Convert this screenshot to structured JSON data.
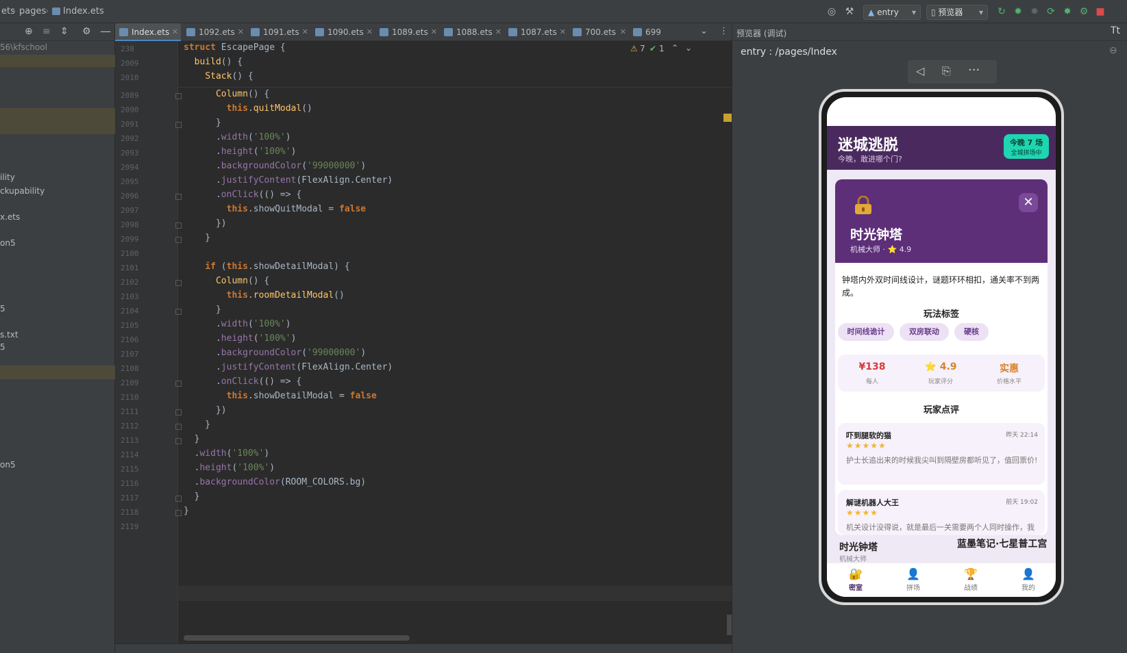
{
  "breadcrumb": {
    "seg1": "ets",
    "seg2": "pages",
    "seg3": "Index.ets"
  },
  "toolbar": {
    "run_config": "entry",
    "device": "预览器"
  },
  "project": {
    "root": "56\\kfschool",
    "items": [
      "ility",
      "ckupability",
      "x.ets",
      "on5",
      "5",
      "s.txt",
      "5",
      "on5"
    ]
  },
  "tabs": [
    {
      "label": "Index.ets",
      "active": true
    },
    {
      "label": "1092.ets"
    },
    {
      "label": "1091.ets"
    },
    {
      "label": "1090.ets"
    },
    {
      "label": "1089.ets"
    },
    {
      "label": "1088.ets"
    },
    {
      "label": "1087.ets"
    },
    {
      "label": "700.ets"
    },
    {
      "label": "699"
    }
  ],
  "editor": {
    "warnings": "7",
    "checks": "1",
    "sticky_lines": [
      {
        "num": "238",
        "code": "struct EscapePage {"
      },
      {
        "num": "2009",
        "code": "  build() {"
      },
      {
        "num": "2010",
        "code": "    Stack() {"
      }
    ],
    "lines": [
      {
        "num": "2089",
        "code": "      Column() {"
      },
      {
        "num": "2090",
        "code": "        this.quitModal()"
      },
      {
        "num": "2091",
        "code": "      }"
      },
      {
        "num": "2092",
        "code": "      .width('100%')"
      },
      {
        "num": "2093",
        "code": "      .height('100%')"
      },
      {
        "num": "2094",
        "code": "      .backgroundColor('99000000')"
      },
      {
        "num": "2095",
        "code": "      .justifyContent(FlexAlign.Center)"
      },
      {
        "num": "2096",
        "code": "      .onClick(() => {"
      },
      {
        "num": "2097",
        "code": "        this.showQuitModal = false"
      },
      {
        "num": "2098",
        "code": "      })"
      },
      {
        "num": "2099",
        "code": "    }"
      },
      {
        "num": "2100",
        "code": ""
      },
      {
        "num": "2101",
        "code": "    if (this.showDetailModal) {"
      },
      {
        "num": "2102",
        "code": "      Column() {"
      },
      {
        "num": "2103",
        "code": "        this.roomDetailModal()"
      },
      {
        "num": "2104",
        "code": "      }"
      },
      {
        "num": "2105",
        "code": "      .width('100%')"
      },
      {
        "num": "2106",
        "code": "      .height('100%')"
      },
      {
        "num": "2107",
        "code": "      .backgroundColor('99000000')"
      },
      {
        "num": "2108",
        "code": "      .justifyContent(FlexAlign.Center)"
      },
      {
        "num": "2109",
        "code": "      .onClick(() => {"
      },
      {
        "num": "2110",
        "code": "        this.showDetailModal = false"
      },
      {
        "num": "2111",
        "code": "      })"
      },
      {
        "num": "2112",
        "code": "    }"
      },
      {
        "num": "2113",
        "code": "  }"
      },
      {
        "num": "2114",
        "code": "  .width('100%')"
      },
      {
        "num": "2115",
        "code": "  .height('100%')"
      },
      {
        "num": "2116",
        "code": "  .backgroundColor(ROOM_COLORS.bg)"
      },
      {
        "num": "2117",
        "code": "  }"
      },
      {
        "num": "2118",
        "code": "}"
      },
      {
        "num": "2119",
        "code": ""
      }
    ]
  },
  "previewer": {
    "title": "预览器 (调试)",
    "route": "entry : /pages/Index"
  },
  "app": {
    "title": "迷城逃脱",
    "subtitle": "今晚，敢进哪个门?",
    "badge_main": "今晚 7 场",
    "badge_sub": "全城拼场中",
    "modal": {
      "room_name": "时光钟塔",
      "meta": "机械大师 · ⭐ 4.9",
      "description": "钟塔内外双时间线设计，谜题环环相扣，通关率不到两成。",
      "tags_title": "玩法标签",
      "tags": [
        "时间线诡计",
        "双房联动",
        "硬核"
      ],
      "stats": [
        {
          "value": "¥138",
          "label": "每人",
          "color": "#d93a3a"
        },
        {
          "value": "⭐ 4.9",
          "label": "玩家评分",
          "color": "#d9832a"
        },
        {
          "value": "实惠",
          "label": "价格水平",
          "color": "#d9832a"
        }
      ],
      "reviews_title": "玩家点评",
      "reviews": [
        {
          "user": "吓到腿软的猫",
          "date": "昨天 22:14",
          "stars": "★★★★★",
          "content": "护士长追出来的时候我尖叫到隔壁房都听见了，值回票价!"
        },
        {
          "user": "解谜机器人大王",
          "date": "前天 19:02",
          "stars": "★★★★",
          "content": "机关设计没得说，就是最后一关需要两个人同时操作，我"
        }
      ]
    },
    "under_room1": "时光钟塔",
    "under_room1_sub": "机械大师",
    "under_room2": "蓝墨笔记·七星普工宫",
    "nav": [
      {
        "label": "密室",
        "icon": "🔐",
        "active": true
      },
      {
        "label": "拼场",
        "icon": "👤"
      },
      {
        "label": "战绩",
        "icon": "🏆"
      },
      {
        "label": "我的",
        "icon": "👤"
      }
    ]
  }
}
